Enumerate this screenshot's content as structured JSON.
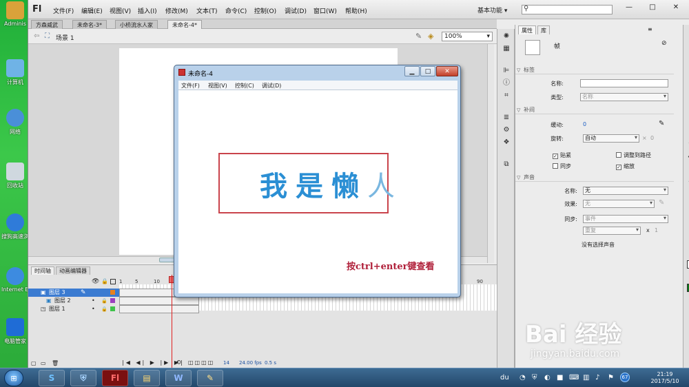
{
  "desktop": {
    "icons": [
      {
        "label": "Adminis",
        "icon": "user-folder-icon",
        "color": "#d9a23a"
      },
      {
        "label": "计算机",
        "icon": "computer-icon",
        "color": "#6fb3e6"
      },
      {
        "label": "网络",
        "icon": "network-icon",
        "color": "#4a8fd8"
      },
      {
        "label": "回收站",
        "icon": "recycle-bin-icon",
        "color": "#cfd8df"
      },
      {
        "label": "搜狗高速浏览器",
        "icon": "sogou-browser-icon",
        "color": "#2f7bd9"
      },
      {
        "label": "Internet Explorer",
        "icon": "ie-icon",
        "color": "#3d8be0"
      },
      {
        "label": "电脑管家",
        "icon": "pc-manager-icon",
        "color": "#1f6cd6"
      }
    ]
  },
  "flash": {
    "logo": "Fl",
    "menu": [
      "文件(F)",
      "编辑(E)",
      "视图(V)",
      "插入(I)",
      "修改(M)",
      "文本(T)",
      "命令(C)",
      "控制(O)",
      "调试(D)",
      "窗口(W)",
      "帮助(H)"
    ],
    "workspace_label": "基本功能",
    "window_buttons": [
      "—",
      "□",
      "✕"
    ],
    "doc_tabs": [
      "方森威武",
      "未命名-3*",
      "小桥流水人家",
      "未命名-4*"
    ],
    "scene_label": "场景 1",
    "zoom": "100%",
    "timeline": {
      "tabs": [
        "时间轴",
        "动画编辑器"
      ],
      "ruler": [
        "1",
        "5",
        "10",
        "90"
      ],
      "layers": [
        {
          "name": "图层 3",
          "color": "#e8821e",
          "selected": true
        },
        {
          "name": "图层 2",
          "color": "#9b3fbf",
          "selected": false
        },
        {
          "name": "图层 1",
          "color": "#3fc24a",
          "selected": false
        }
      ],
      "status_frame": "14",
      "status_fps": "24.00 fps",
      "status_time": "0.5 s"
    },
    "properties": {
      "tabs": [
        "属性",
        "库"
      ],
      "title": "帧",
      "sections": {
        "label": "标签",
        "tween": "补间",
        "sound": "声音"
      },
      "fields": {
        "name_label": "名称:",
        "type_label": "类型:",
        "type_value": "名称",
        "ease_label": "缓动:",
        "ease_value": "0",
        "rotate_label": "旋转:",
        "rotate_value": "自动",
        "rotate_count": "0",
        "snap": "贴紧",
        "orient": "调整到路径",
        "sync": "同步",
        "scale": "缩放",
        "sound_name_label": "名称:",
        "sound_name_value": "无",
        "effect_label": "效果:",
        "effect_value": "无",
        "sync_label": "同步:",
        "sync_value": "事件",
        "repeat_value": "重复",
        "repeat_x": "x",
        "repeat_count": "1",
        "no_sound": "没有选择声音"
      }
    }
  },
  "player": {
    "title": "未命名-4",
    "menu": [
      "文件(F)",
      "视图(V)",
      "控制(C)",
      "调试(D)"
    ],
    "text_full": "我是懒",
    "text_partial": "人",
    "hint": "按ctrl+enter键查看",
    "frame_color": "#c9434b"
  },
  "taskbar": {
    "apps": [
      {
        "label": "S",
        "icon": "sogou-task-icon"
      },
      {
        "label": "⛨",
        "icon": "shield-task-icon"
      },
      {
        "label": "Fl",
        "icon": "flash-task-icon"
      },
      {
        "label": "▤",
        "icon": "explorer-task-icon"
      },
      {
        "label": "W",
        "icon": "word-task-icon"
      },
      {
        "label": "✎",
        "icon": "paint-task-icon"
      }
    ],
    "tray_badge": "67",
    "time": "21:19",
    "date": "2017/5/10"
  },
  "watermark": {
    "brand": "Bai 经验",
    "url": "jingyan.baidu.com"
  }
}
